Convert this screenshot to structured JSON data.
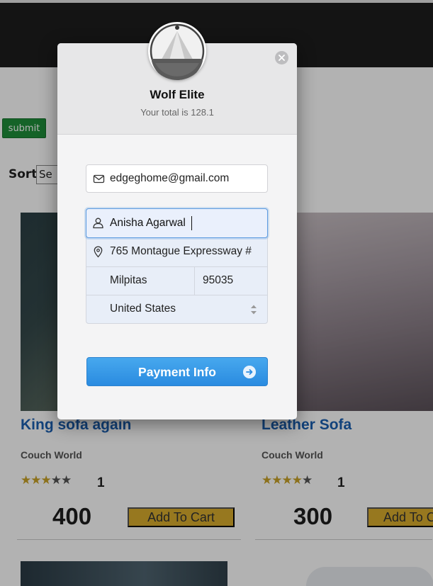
{
  "page": {
    "submit_label": "submit",
    "sort_label": "Sort",
    "sort_value": "Se",
    "products": [
      {
        "title": "King sofa again",
        "store": "Couch World",
        "rating": 3,
        "rating_count": "1",
        "price": "400",
        "cart_label": "Add To Cart"
      },
      {
        "title": "Leather Sofa",
        "store": "Couch World",
        "rating": 4,
        "rating_count": "1",
        "price": "300",
        "cart_label": "Add To C"
      }
    ]
  },
  "checkout": {
    "merchant_name": "Wolf Elite",
    "total_text": "Your total is 128.1",
    "email": "edgeghome@gmail.com",
    "name": "Anisha Agarwal",
    "street": "765 Montague Expressway #",
    "city": "Milpitas",
    "zip": "95035",
    "country": "United States",
    "pay_label": "Payment Info"
  },
  "colors": {
    "accent_blue": "#2a8be0",
    "star_gold": "#c9a227",
    "cart_gold": "#d9ad2d",
    "submit_green": "#1f8f3a",
    "title_blue": "#1a5fb0"
  },
  "icons": [
    "close-icon",
    "mail-icon",
    "user-icon",
    "location-pin-icon",
    "select-arrows-icon",
    "arrow-right-icon",
    "star-icon"
  ]
}
